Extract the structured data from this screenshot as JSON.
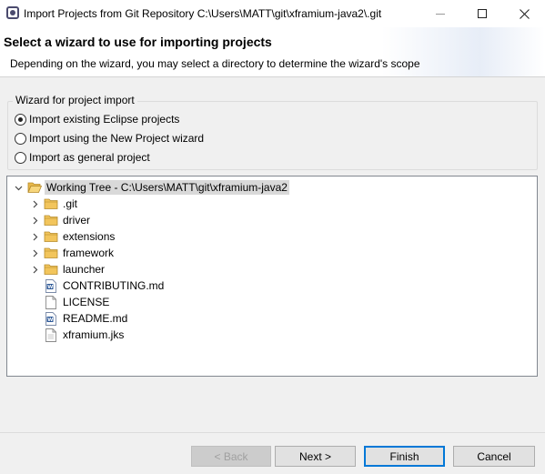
{
  "window": {
    "title": "Import Projects from Git Repository C:\\Users\\MATT\\git\\xframium-java2\\.git",
    "minimize_glyph": "—",
    "maximize_glyph": "☐",
    "close_glyph": "✕"
  },
  "header": {
    "title": "Select a wizard to use for importing projects",
    "description": "Depending on the wizard, you may select a directory to determine the wizard's scope"
  },
  "wizard_group": {
    "legend": "Wizard for project import",
    "options": [
      {
        "label": "Import existing Eclipse projects",
        "checked": true
      },
      {
        "label": "Import using the New Project wizard",
        "checked": false
      },
      {
        "label": "Import as general project",
        "checked": false
      }
    ]
  },
  "tree": {
    "root": {
      "label": "Working Tree - C:\\Users\\MATT\\git\\xframium-java2",
      "expanded": true,
      "icon": "folder-open-icon"
    },
    "children": [
      {
        "label": ".git",
        "type": "folder",
        "icon": "folder-icon"
      },
      {
        "label": "driver",
        "type": "folder",
        "icon": "folder-icon"
      },
      {
        "label": "extensions",
        "type": "folder",
        "icon": "folder-icon"
      },
      {
        "label": "framework",
        "type": "folder",
        "icon": "folder-icon"
      },
      {
        "label": "launcher",
        "type": "folder",
        "icon": "folder-icon"
      },
      {
        "label": "CONTRIBUTING.md",
        "type": "file",
        "icon": "word-document-icon"
      },
      {
        "label": "LICENSE",
        "type": "file",
        "icon": "file-icon"
      },
      {
        "label": "README.md",
        "type": "file",
        "icon": "word-document-icon"
      },
      {
        "label": "xframium.jks",
        "type": "file",
        "icon": "file-icon"
      }
    ]
  },
  "buttons": {
    "back": "< Back",
    "next": "Next >",
    "finish": "Finish",
    "cancel": "Cancel"
  },
  "colors": {
    "selection": "#d9d9d9",
    "folder": "#f2c55c",
    "default_button_border": "#0078d7"
  }
}
